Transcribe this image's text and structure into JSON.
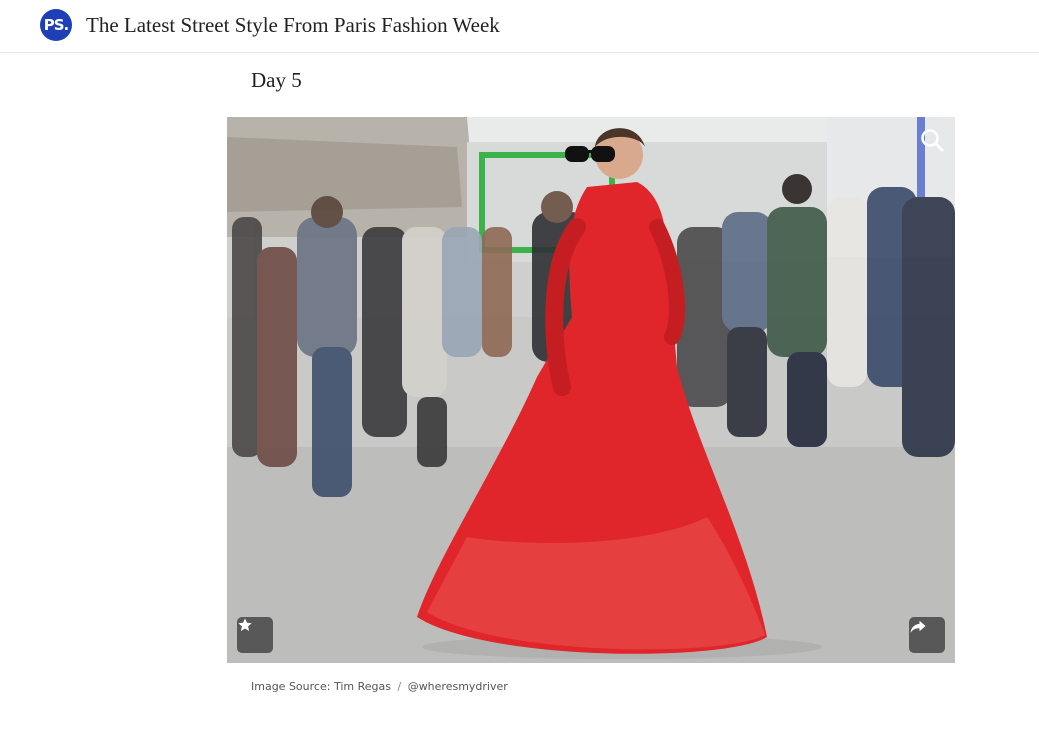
{
  "header": {
    "logo_text": "PS.",
    "title": "The Latest Street Style From Paris Fashion Week"
  },
  "article": {
    "section_heading": "Day 5",
    "image": {
      "alt": "Woman in a red tulle gown and sunglasses walking on a Paris street",
      "zoom_icon": "magnifier-icon",
      "pin_icon": "star-icon",
      "share_icon": "share-arrow-icon"
    },
    "caption": {
      "label": "Image Source:",
      "photographer": "Tim Regas",
      "separator": "/",
      "handle": "@wheresmydriver"
    }
  },
  "colors": {
    "brand": "#1f3fb7",
    "dress": "#e0262a",
    "button_bg": "#464646"
  }
}
